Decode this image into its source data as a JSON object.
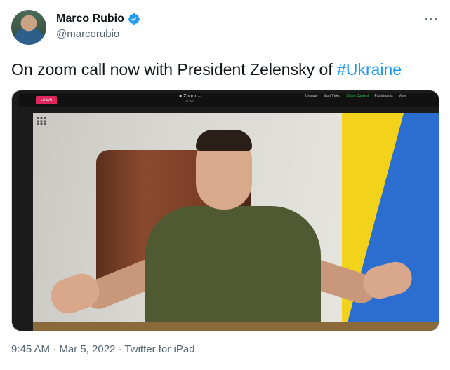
{
  "author": {
    "display_name": "Marco Rubio",
    "handle": "@marcorubio",
    "verified_icon": "verified-badge-icon",
    "avatar_icon": "avatar"
  },
  "tweet": {
    "text_before": "On zoom call now with President Zelensky of ",
    "hashtag": "#Ukraine"
  },
  "media": {
    "zoom": {
      "leave_label": "Leave",
      "title": "Zoom",
      "subtitle": "01:48",
      "controls": [
        "Unmute",
        "Start Video",
        "Share Content",
        "Participants",
        "More"
      ]
    }
  },
  "meta": {
    "text": "9:45 AM · Mar 5, 2022 · Twitter for iPad"
  },
  "colors": {
    "accent": "#1d9bf0",
    "secondary_text": "#536471"
  }
}
